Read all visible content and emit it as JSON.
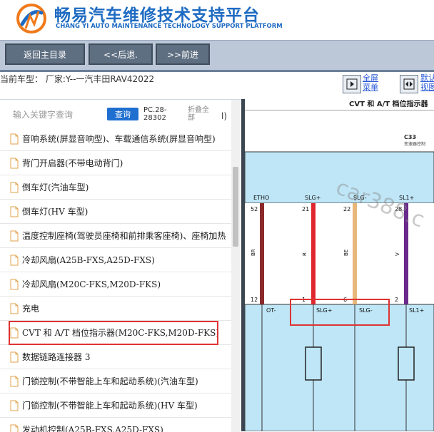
{
  "header": {
    "title_cn": "畅易汽车维修技术支持平台",
    "title_en": "CHANG YI AUTO MAINTENANCE TECHNOLOGY SUPPORT PLATFORM",
    "brand_color": "#1e6bc2"
  },
  "toolbar": {
    "home_label": "返回主目录",
    "back_label": "<<后退.",
    "forward_label": ">>前进"
  },
  "vehicle": {
    "text": "当前车型： 厂家:Y--一汽丰田RAV42022"
  },
  "view_controls": {
    "fullscreen_label_1": "全屏",
    "fullscreen_label_2": "菜单",
    "default_label_1": "默认",
    "default_label_2": "视图"
  },
  "search": {
    "placeholder": "输入关键字查询",
    "query_label": "查询",
    "code_1": "PC.28-",
    "code_2": "28302",
    "collapse_1": "折叠全",
    "collapse_2": "部",
    "paren": "l)"
  },
  "list": {
    "items": [
      {
        "label": "音响系统(屏显音响型)、车载通信系统(屏显音响型)"
      },
      {
        "label": "背门开启器(不带电动背门)"
      },
      {
        "label": "倒车灯(汽油车型)"
      },
      {
        "label": "倒车灯(HV 车型)"
      },
      {
        "label": "温度控制座椅(驾驶员座椅和前排乘客座椅)、座椅加热"
      },
      {
        "label": "冷却风扇(A25B-FXS,A25D-FXS)"
      },
      {
        "label": "冷却风扇(M20C-FKS,M20D-FKS)"
      },
      {
        "label": "充电"
      },
      {
        "label": "CVT 和 A/T 档位指示器(M20C-FKS,M20D-FKS)"
      },
      {
        "label": "数据链路连接器 3"
      },
      {
        "label": "门锁控制(不带智能上车和起动系统)(汽油车型)"
      },
      {
        "label": "门锁控制(不带智能上车和起动系统)(HV 车型)"
      },
      {
        "label": "发动机控制(A25B-FXS,A25D-FXS)"
      }
    ],
    "selected_index": 8
  },
  "diagram": {
    "title": "CVT 和 A/T 档位指示器",
    "connector": "C33",
    "connector_desc": "变速器控制",
    "top_labels": [
      "ETHO",
      "SLG+",
      "SLG-",
      "SL1+"
    ],
    "pin_top": [
      "52",
      "21",
      "22",
      "28"
    ],
    "wire_colors_text": [
      "BR",
      "R",
      "BE",
      "V"
    ],
    "pin_bottom": [
      "12",
      "1",
      "6",
      "2"
    ],
    "bottom_labels": [
      "OT-",
      "SLG+",
      "SLG-",
      "SL1+"
    ],
    "watermark": "car388.c",
    "wire_colors": [
      "#8b2a2a",
      "#e0262e",
      "#e8b87a",
      "#6a2a8c"
    ]
  }
}
